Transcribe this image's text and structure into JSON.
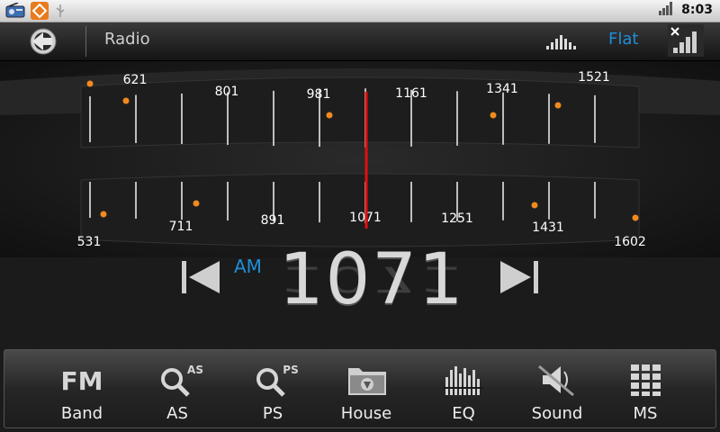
{
  "status_bar": {
    "time": "8:03"
  },
  "title_bar": {
    "title": "Radio",
    "eq_preset": "Flat"
  },
  "dial": {
    "pointer_value": 1071,
    "upper_labels": [
      "621",
      "801",
      "981",
      "1161",
      "1341",
      "1521"
    ],
    "lower_labels": [
      "531",
      "711",
      "891",
      "1071",
      "1251",
      "1431",
      "1602"
    ]
  },
  "tuner": {
    "band": "AM",
    "frequency": "1071"
  },
  "toolbar": {
    "buttons": [
      {
        "label": "Band",
        "icon": "fm-band-icon",
        "icon_text": "FM"
      },
      {
        "label": "AS",
        "icon": "auto-store-search-icon",
        "icon_text": "AS"
      },
      {
        "label": "PS",
        "icon": "preset-scan-search-icon",
        "icon_text": "PS"
      },
      {
        "label": "House",
        "icon": "house-folder-icon"
      },
      {
        "label": "EQ",
        "icon": "equalizer-icon"
      },
      {
        "label": "Sound",
        "icon": "speaker-muted-icon"
      },
      {
        "label": "MS",
        "icon": "grid-keypad-icon"
      }
    ]
  },
  "colors": {
    "accent": "#1e8fd8",
    "pointer": "#e01010",
    "marker": "#f08a20"
  }
}
